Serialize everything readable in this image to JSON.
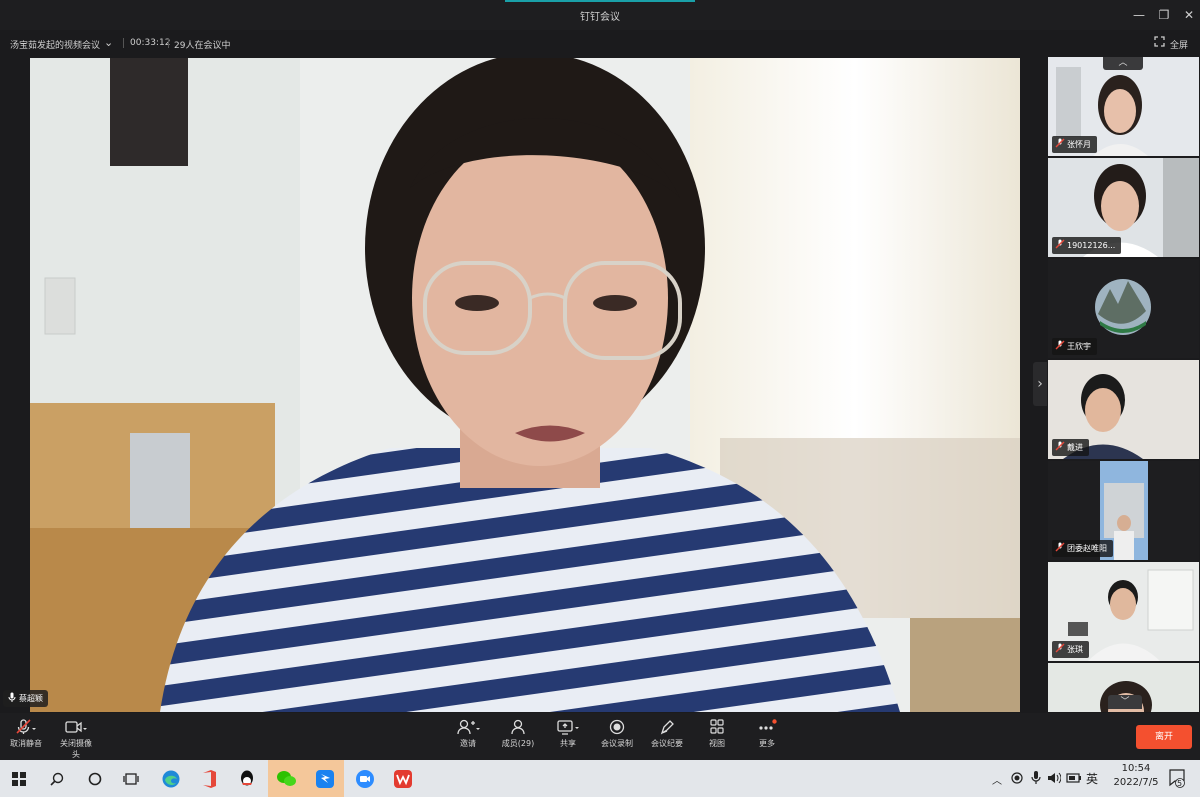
{
  "window": {
    "title": "钉钉会议"
  },
  "meeting": {
    "name": "汤宝茹发起的视频会议",
    "duration": "00:33:12",
    "count_text": "29人在会议中",
    "fullscreen_label": "全屏"
  },
  "main_video": {
    "speaker": "蔡超颖"
  },
  "participants": [
    {
      "name": "张怀月"
    },
    {
      "name": "19012126..."
    },
    {
      "name": "王欣宇"
    },
    {
      "name": "戴进"
    },
    {
      "name": "团委赵唯阳"
    },
    {
      "name": "张琪"
    }
  ],
  "toolbar": {
    "mute": "取消静音",
    "camera": "关闭摄像头",
    "invite": "邀请",
    "members": "成员(29)",
    "share": "共享",
    "record": "会议录制",
    "minutes": "会议纪要",
    "view": "视图",
    "more": "更多",
    "leave": "离开"
  },
  "taskbar": {
    "time": "10:54",
    "date": "2022/7/5",
    "ime": "英",
    "notifications": "5"
  },
  "colors": {
    "accent": "#1aa0a8",
    "leave": "#f4502f",
    "mute_red": "#e5483a"
  }
}
